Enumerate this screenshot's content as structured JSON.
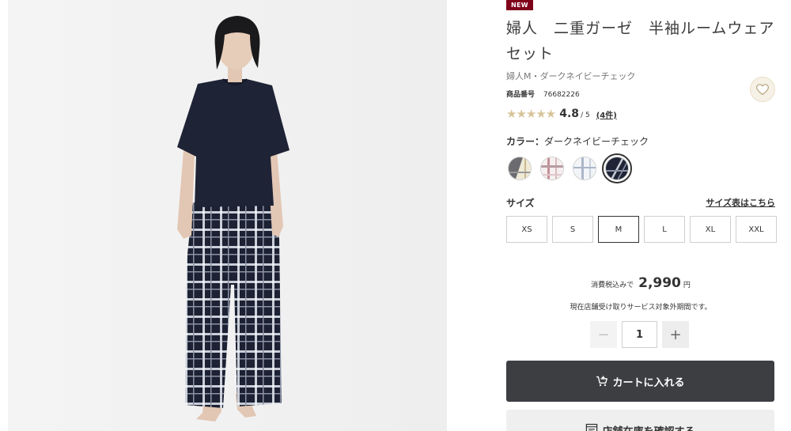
{
  "product": {
    "badge": "NEW",
    "title": "婦人　二重ガーゼ　半袖ルームウェアセット",
    "subtitle": "婦人M・ダークネイビーチェック",
    "sku_label": "商品番号",
    "sku": "76682226",
    "rating": {
      "score": "4.8",
      "out_of": "/ 5",
      "count": "(4件)",
      "stars_filled": 5
    }
  },
  "colors": {
    "label": "カラー：",
    "selected": "ダークネイビーチェック",
    "options": [
      {
        "name": "グレーチェック",
        "colors": [
          "#6b6b70",
          "#efe9d6"
        ]
      },
      {
        "name": "ピンクチェック",
        "colors": [
          "#f6efef",
          "#b89ba0"
        ]
      },
      {
        "name": "ブルーチェック",
        "colors": [
          "#f2f4f7",
          "#aab6c8"
        ]
      },
      {
        "name": "ダークネイビーチェック",
        "colors": [
          "#1f2436",
          "#c8ccd6"
        ],
        "selected": true
      }
    ]
  },
  "sizes": {
    "label": "サイズ",
    "chart_link": "サイズ表はこちら",
    "options": [
      "XS",
      "S",
      "M",
      "L",
      "XL",
      "XXL"
    ],
    "selected": "M"
  },
  "price": {
    "prefix": "消費税込みで",
    "amount": "2,990",
    "unit": "円"
  },
  "notice": "現在店舗受け取りサービス対象外期間です。",
  "quantity": {
    "value": "1",
    "minus": "−",
    "plus": "+"
  },
  "buttons": {
    "cart": "カートに入れる",
    "store": "店舗在庫を確認する"
  },
  "icons": {
    "favorite": "heart-icon",
    "cart": "cart-plus-icon",
    "store": "store-icon"
  }
}
